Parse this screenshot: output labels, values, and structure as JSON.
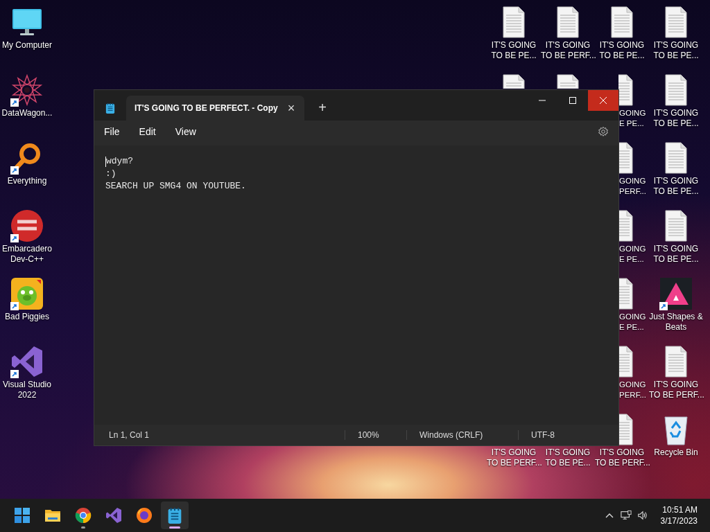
{
  "desktop": {
    "left_icons": [
      {
        "label": "My Computer",
        "shortcut": false
      },
      {
        "label": "DataWagon...",
        "shortcut": true
      },
      {
        "label": "Everything",
        "shortcut": true
      },
      {
        "label": "Embarcadero Dev-C++",
        "shortcut": true
      },
      {
        "label": "Bad Piggies",
        "shortcut": true
      },
      {
        "label": "Visual Studio 2022",
        "shortcut": true
      }
    ],
    "right_columns": [
      {
        "top": [
          {
            "kind": "file",
            "lines": [
              "IT'S GOING",
              "TO BE PE..."
            ]
          },
          {
            "kind": "peek"
          }
        ],
        "bottom": [
          {
            "lines": [
              "IT'S GOING",
              "TO BE PERF..."
            ]
          }
        ]
      },
      {
        "top": [
          {
            "kind": "file",
            "lines": [
              "IT'S GOING",
              "TO BE PERF..."
            ]
          },
          {
            "kind": "peek"
          }
        ],
        "bottom": [
          {
            "lines": [
              "IT'S GOING",
              "TO BE PE..."
            ]
          }
        ]
      },
      {
        "top": [
          {
            "kind": "file",
            "lines": [
              "IT'S GOING",
              "TO BE PE..."
            ]
          },
          {
            "kind": "partial",
            "lines": [
              "GOING",
              "E PE..."
            ]
          },
          {
            "kind": "partial",
            "lines": [
              "GOING",
              "PERF..."
            ]
          },
          {
            "kind": "partial",
            "lines": [
              "GOING",
              "E PE..."
            ]
          },
          {
            "kind": "partial",
            "lines": [
              "GOING",
              "E PE..."
            ]
          },
          {
            "kind": "partial",
            "lines": [
              "GOING",
              "PERF..."
            ]
          },
          {
            "kind": "edge",
            "lines": [
              "IT'S GOING",
              "TO BE PERF..."
            ]
          }
        ]
      },
      {
        "top": [
          {
            "kind": "file",
            "lines": [
              "IT'S GOING",
              "TO BE PE..."
            ]
          },
          {
            "kind": "file",
            "lines": [
              "IT'S GOING",
              "TO BE PE..."
            ]
          },
          {
            "kind": "file",
            "lines": [
              "IT'S GOING",
              "TO BE PE..."
            ]
          },
          {
            "kind": "file",
            "lines": [
              "IT'S GOING",
              "TO BE PE..."
            ]
          },
          {
            "kind": "app",
            "lines": [
              "Just Shapes &",
              "Beats"
            ]
          },
          {
            "kind": "file",
            "lines": [
              "IT'S GOING",
              "TO BE PERF..."
            ]
          },
          {
            "kind": "recycle",
            "lines": [
              "Recycle Bin"
            ]
          }
        ]
      }
    ]
  },
  "window": {
    "tab_title": "IT'S GOING TO BE PERFECT. - Copy",
    "tab_close": "×",
    "new_tab": "+",
    "close_hovered": true,
    "menu": [
      "File",
      "Edit",
      "View"
    ],
    "lines": [
      "wdym?",
      ":)",
      "SEARCH UP SMG4 ON YOUTUBE."
    ],
    "status_bar": [
      "Ln 1, Col 1",
      "100%",
      "Windows (CRLF)",
      "UTF-8"
    ]
  },
  "taskbar": {
    "apps": [
      {
        "running": false,
        "active": false
      },
      {
        "running": false,
        "active": false
      },
      {
        "running": true,
        "active": false
      },
      {
        "running": false,
        "active": false
      },
      {
        "running": false,
        "active": false
      },
      {
        "running": true,
        "active": true
      }
    ],
    "time": "10:51 AM",
    "date": "3/17/2023"
  }
}
